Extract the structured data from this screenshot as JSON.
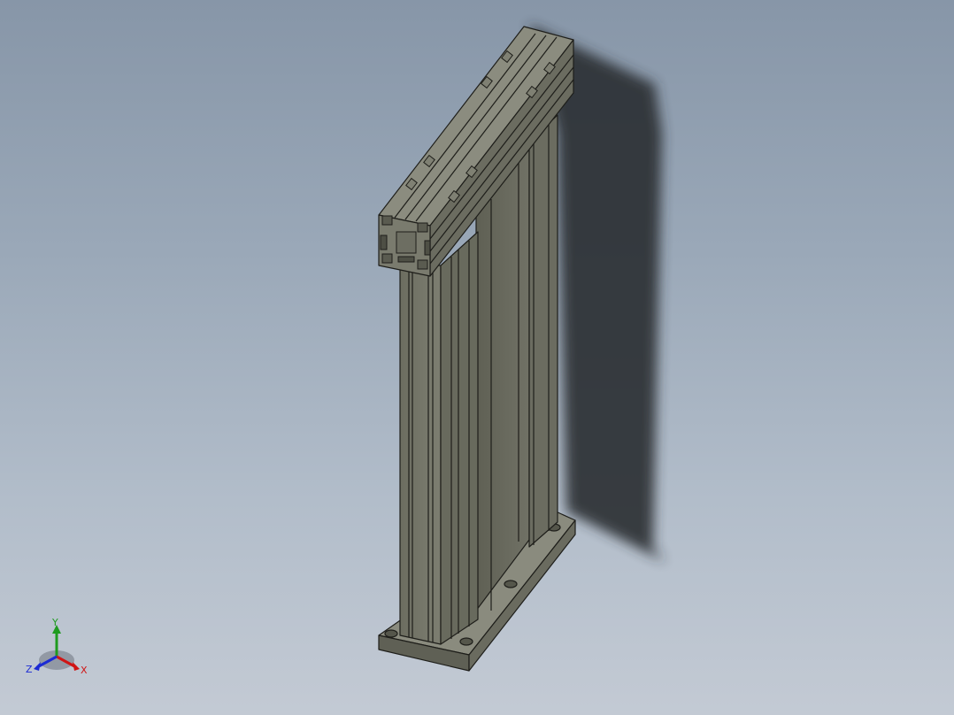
{
  "viewport": {
    "model": "aluminum-profile-frame-assembly",
    "background_top": "#8796a8",
    "background_bottom": "#c3cad4",
    "part_color": "#76776a"
  },
  "triad": {
    "y_label": "Y",
    "z_label": "Z",
    "x_label": "X",
    "y_color": "#1f9b1f",
    "z_color": "#1c2bd4",
    "x_color": "#d01515"
  }
}
